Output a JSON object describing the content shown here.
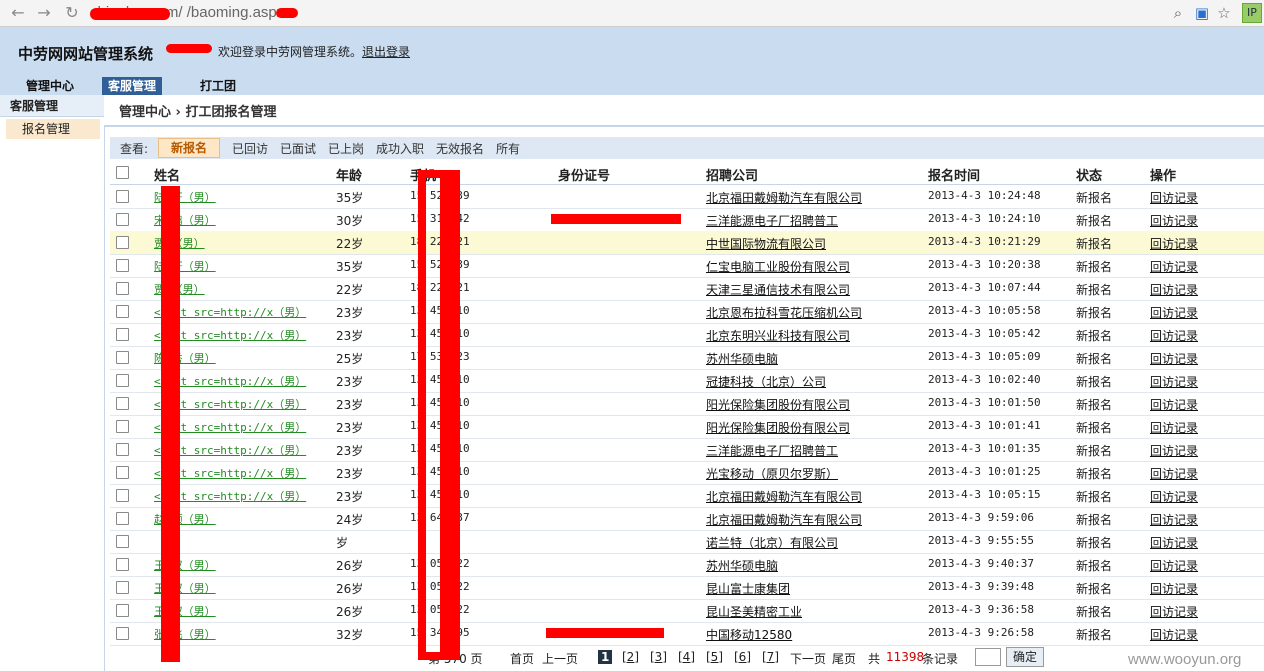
{
  "browser": {
    "url": "chinalao.com/    /baoming.aspx",
    "ip_badge": "IP"
  },
  "header": {
    "system_name": "中劳网网站管理系统",
    "welcome": "欢迎登录中劳网管理系统。",
    "logout": "退出登录",
    "tabs": [
      "管理中心",
      "客服管理",
      "打工团"
    ]
  },
  "sidebar": {
    "title": "客服管理",
    "item": "报名管理"
  },
  "breadcrumb": {
    "root": "管理中心",
    "sep": "›",
    "current": "打工团报名管理"
  },
  "filters": {
    "label": "查看:",
    "items": [
      "新报名",
      "已回访",
      "已面试",
      "已上岗",
      "成功入职",
      "无效报名",
      "所有"
    ]
  },
  "table": {
    "headers": [
      "姓名",
      "年龄",
      "手机",
      "身份证号",
      "招聘公司",
      "报名时间",
      "状态",
      "操作"
    ],
    "rows": [
      {
        "name": "陆 轩（男）",
        "age": "35岁",
        "phone": "15 52 139",
        "company": "北京福田戴姆勒汽车有限公司",
        "time": "2013-4-3  10:24:48",
        "status": "新报名",
        "action": "回访记录"
      },
      {
        "name": "宋 鹏（男）",
        "age": "30岁",
        "phone": "15 31 142",
        "company": "三洋能源电子厂招聘普工",
        "time": "2013-4-3  10:24:10",
        "status": "新报名",
        "action": "回访记录"
      },
      {
        "name": "贾 （男）",
        "age": "22岁",
        "phone": "18 22 321",
        "company": "中世国际物流有限公司",
        "time": "2013-4-3  10:21:29",
        "status": "新报名",
        "action": "回访记录"
      },
      {
        "name": "陆 轩（男）",
        "age": "35岁",
        "phone": "15 52 139",
        "company": "仁宝电脑工业股份有限公司",
        "time": "2013-4-3  10:20:38",
        "status": "新报名",
        "action": "回访记录"
      },
      {
        "name": "贾 （男）",
        "age": "22岁",
        "phone": "18 22 321",
        "company": "天津三星通信技术有限公司",
        "time": "2013-4-3  10:07:44",
        "status": "新报名",
        "action": "回访记录"
      },
      {
        "name": "< ipt src=http://x（男）",
        "age": "23岁",
        "phone": "13 45 910",
        "company": "北京恩布拉科雪花压缩机公司",
        "time": "2013-4-3  10:05:58",
        "status": "新报名",
        "action": "回访记录"
      },
      {
        "name": "< ipt src=http://x（男）",
        "age": "23岁",
        "phone": "13 45 910",
        "company": "北京东明兴业科技有限公司",
        "time": "2013-4-3  10:05:42",
        "status": "新报名",
        "action": "回访记录"
      },
      {
        "name": "陈 秀（男）",
        "age": "25岁",
        "phone": "17 53 723",
        "company": "苏州华硕电脑",
        "time": "2013-4-3  10:05:09",
        "status": "新报名",
        "action": "回访记录"
      },
      {
        "name": "< ipt src=http://x（男）",
        "age": "23岁",
        "phone": "13 45 910",
        "company": "冠捷科技（北京）公司",
        "time": "2013-4-3  10:02:40",
        "status": "新报名",
        "action": "回访记录"
      },
      {
        "name": "< ipt src=http://x（男）",
        "age": "23岁",
        "phone": "13 45 910",
        "company": "阳光保险集团股份有限公司",
        "time": "2013-4-3  10:01:50",
        "status": "新报名",
        "action": "回访记录"
      },
      {
        "name": "< ipt src=http://x（男）",
        "age": "23岁",
        "phone": "13 45 910",
        "company": "阳光保险集团股份有限公司",
        "time": "2013-4-3  10:01:41",
        "status": "新报名",
        "action": "回访记录"
      },
      {
        "name": "< ipt src=http://x（男）",
        "age": "23岁",
        "phone": "13 45 910",
        "company": "三洋能源电子厂招聘普工",
        "time": "2013-4-3  10:01:35",
        "status": "新报名",
        "action": "回访记录"
      },
      {
        "name": "< ipt src=http://x（男）",
        "age": "23岁",
        "phone": "13 45 910",
        "company": "光宝移动（原贝尔罗斯）",
        "time": "2013-4-3  10:01:25",
        "status": "新报名",
        "action": "回访记录"
      },
      {
        "name": "< ipt src=http://x（男）",
        "age": "23岁",
        "phone": "13 45 910",
        "company": "北京福田戴姆勒汽车有限公司",
        "time": "2013-4-3  10:05:15",
        "status": "新报名",
        "action": "回访记录"
      },
      {
        "name": "赵 顺（男）",
        "age": "24岁",
        "phone": "13 64 637",
        "company": "北京福田戴姆勒汽车有限公司",
        "time": "2013-4-3  9:59:06",
        "status": "新报名",
        "action": "回访记录"
      },
      {
        "name": "",
        "age": "岁",
        "phone": "",
        "company": "诺兰特（北京）有限公司",
        "time": "2013-4-3  9:55:55",
        "status": "新报名",
        "action": "回访记录"
      },
      {
        "name": "王 双（男）",
        "age": "26岁",
        "phone": "13 05 922",
        "company": "苏州华硕电脑",
        "time": "2013-4-3  9:40:37",
        "status": "新报名",
        "action": "回访记录"
      },
      {
        "name": "王 双（男）",
        "age": "26岁",
        "phone": "13 05 922",
        "company": "昆山富士康集团",
        "time": "2013-4-3  9:39:48",
        "status": "新报名",
        "action": "回访记录"
      },
      {
        "name": "王 双（男）",
        "age": "26岁",
        "phone": "13 05 922",
        "company": "昆山圣美精密工业",
        "time": "2013-4-3  9:36:58",
        "status": "新报名",
        "action": "回访记录"
      },
      {
        "name": "张 飞（男）",
        "age": "32岁",
        "phone": "15 34 595",
        "company": "中国移动12580",
        "time": "2013-4-3  9:26:58",
        "status": "新报名",
        "action": "回访记录"
      }
    ]
  },
  "pager": {
    "page_of": "第 570 页",
    "first": "首页",
    "prev": "上一页",
    "pages": [
      "1",
      "[2]",
      "[3]",
      "[4]",
      "[5]",
      "[6]",
      "[7]"
    ],
    "next": "下一页",
    "last": "尾页",
    "total_prefix": "共",
    "total": "11398",
    "total_suffix": "条记录",
    "ok": "确定"
  },
  "watermark": "www.wooyun.org",
  "colors": {
    "header_bg": "#c9dcf0",
    "tab_active": "#2f5f96",
    "redaction": "#ff0000",
    "link_green": "#238c23",
    "highlight_row": "#fcf9d5"
  }
}
